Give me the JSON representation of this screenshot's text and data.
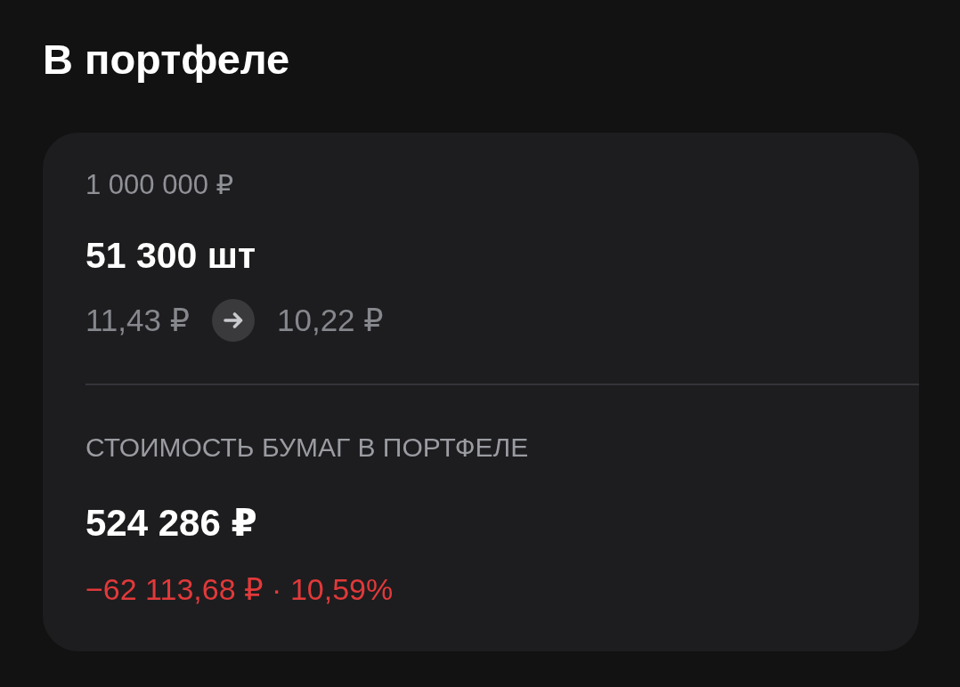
{
  "title": "В портфеле",
  "position": {
    "amount": "1 000 000 ₽",
    "quantity": "51 300 шт",
    "price_from": "11,43 ₽",
    "price_to": "10,22 ₽"
  },
  "value": {
    "label": "СТОИМОСТЬ БУМАГ В ПОРТФЕЛЕ",
    "amount": "524 286 ₽",
    "change": {
      "text": "−62 113,68 ₽ · 10,59%",
      "negative": true
    }
  }
}
